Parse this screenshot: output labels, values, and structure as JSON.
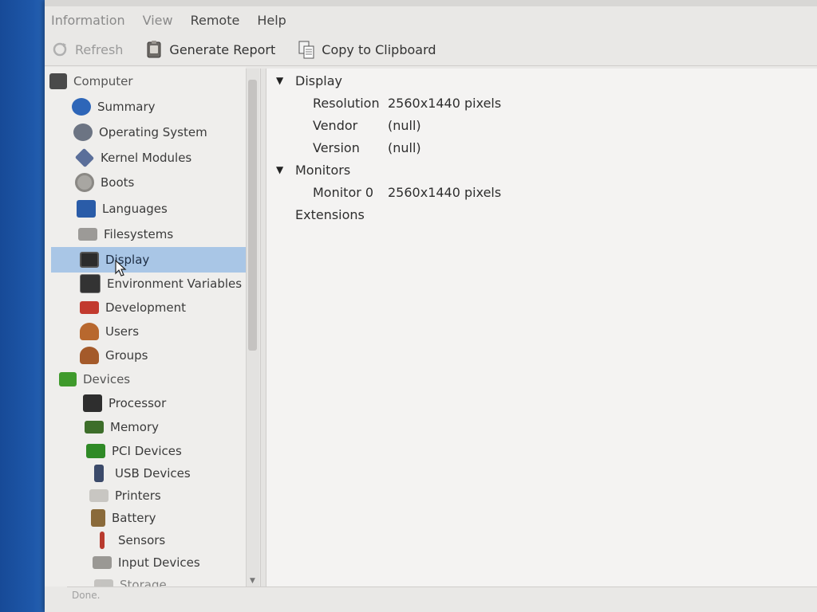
{
  "menubar": {
    "items": [
      {
        "label": "Information"
      },
      {
        "label": "View"
      },
      {
        "label": "Remote"
      },
      {
        "label": "Help"
      }
    ]
  },
  "toolbar": {
    "refresh_label": "Refresh",
    "report_label": "Generate Report",
    "clipboard_label": "Copy to Clipboard"
  },
  "sidebar": {
    "computer_label": "Computer",
    "computer_items": [
      {
        "label": "Summary",
        "icon": "info-icon"
      },
      {
        "label": "Operating System",
        "icon": "gears-icon"
      },
      {
        "label": "Kernel Modules",
        "icon": "module-icon"
      },
      {
        "label": "Boots",
        "icon": "disc-icon"
      },
      {
        "label": "Languages",
        "icon": "flag-icon"
      },
      {
        "label": "Filesystems",
        "icon": "drive-icon"
      },
      {
        "label": "Display",
        "icon": "monitor-icon"
      },
      {
        "label": "Environment Variables",
        "icon": "terminal-icon"
      },
      {
        "label": "Development",
        "icon": "toolbox-icon"
      },
      {
        "label": "Users",
        "icon": "users-icon"
      },
      {
        "label": "Groups",
        "icon": "groups-icon"
      }
    ],
    "devices_label": "Devices",
    "devices_items": [
      {
        "label": "Processor",
        "icon": "cpu-icon"
      },
      {
        "label": "Memory",
        "icon": "ram-icon"
      },
      {
        "label": "PCI Devices",
        "icon": "pci-card-icon"
      },
      {
        "label": "USB Devices",
        "icon": "usb-icon"
      },
      {
        "label": "Printers",
        "icon": "printer-icon"
      },
      {
        "label": "Battery",
        "icon": "battery-icon"
      },
      {
        "label": "Sensors",
        "icon": "thermometer-icon"
      },
      {
        "label": "Input Devices",
        "icon": "keyboard-icon"
      },
      {
        "label": "Storage",
        "icon": "storage-icon"
      }
    ],
    "selected": "Display"
  },
  "main": {
    "sections": [
      {
        "title": "Display",
        "expanded": true,
        "rows": [
          {
            "key": "Resolution",
            "value": "2560x1440 pixels"
          },
          {
            "key": "Vendor",
            "value": "(null)"
          },
          {
            "key": "Version",
            "value": "(null)"
          }
        ]
      },
      {
        "title": "Monitors",
        "expanded": true,
        "rows": [
          {
            "key": "Monitor 0",
            "value": "2560x1440 pixels"
          }
        ]
      },
      {
        "title": "Extensions",
        "expanded": false,
        "rows": []
      }
    ]
  },
  "statusbar": {
    "text": "Done."
  },
  "colors": {
    "selection": "#a9c6e6",
    "window_bg": "#e9e8e6",
    "desktop": "#1c4f9e"
  }
}
